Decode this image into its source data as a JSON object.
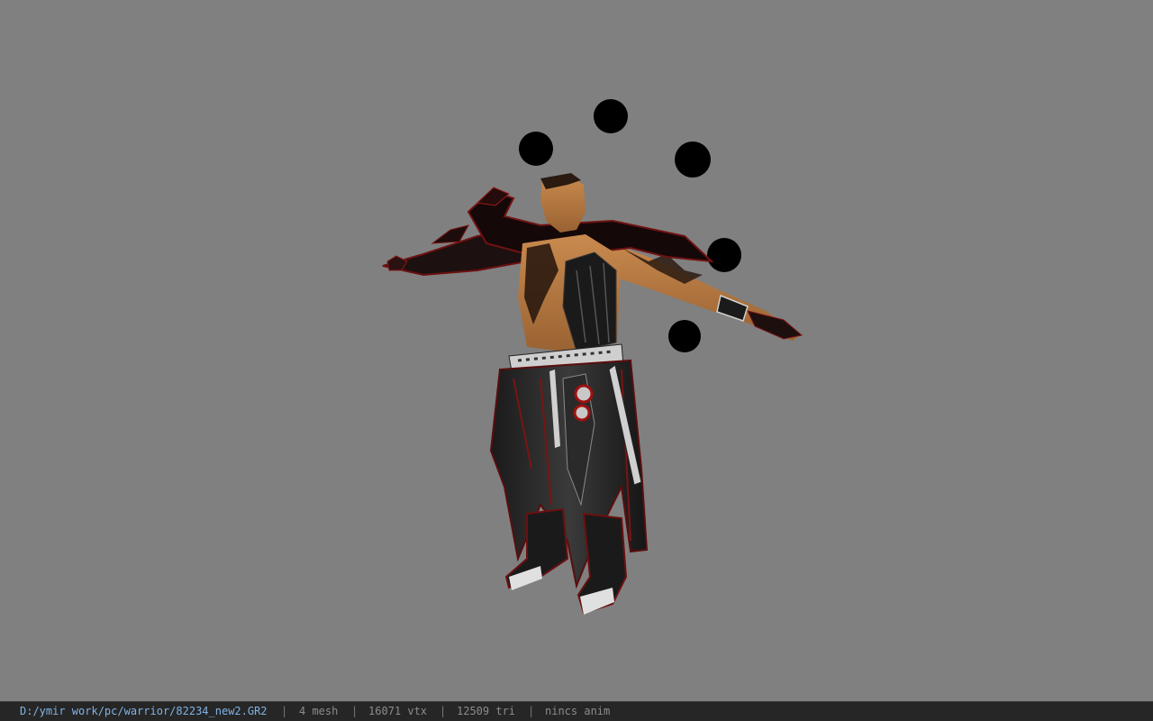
{
  "viewer": {
    "background_color": "#808080",
    "subject": "warrior-character-model",
    "status": {
      "file_path": "D:/ymir work/pc/warrior/82234_new2.GR2",
      "separator": "|",
      "mesh": "4 mesh",
      "vertices": "16071 vtx",
      "triangles": "12509 tri",
      "animation": "nincs anim"
    },
    "colors": {
      "status_bg": "#262626",
      "path_text": "#7fb3e6",
      "status_text": "#8c8c8c",
      "orb": "#000000"
    }
  }
}
